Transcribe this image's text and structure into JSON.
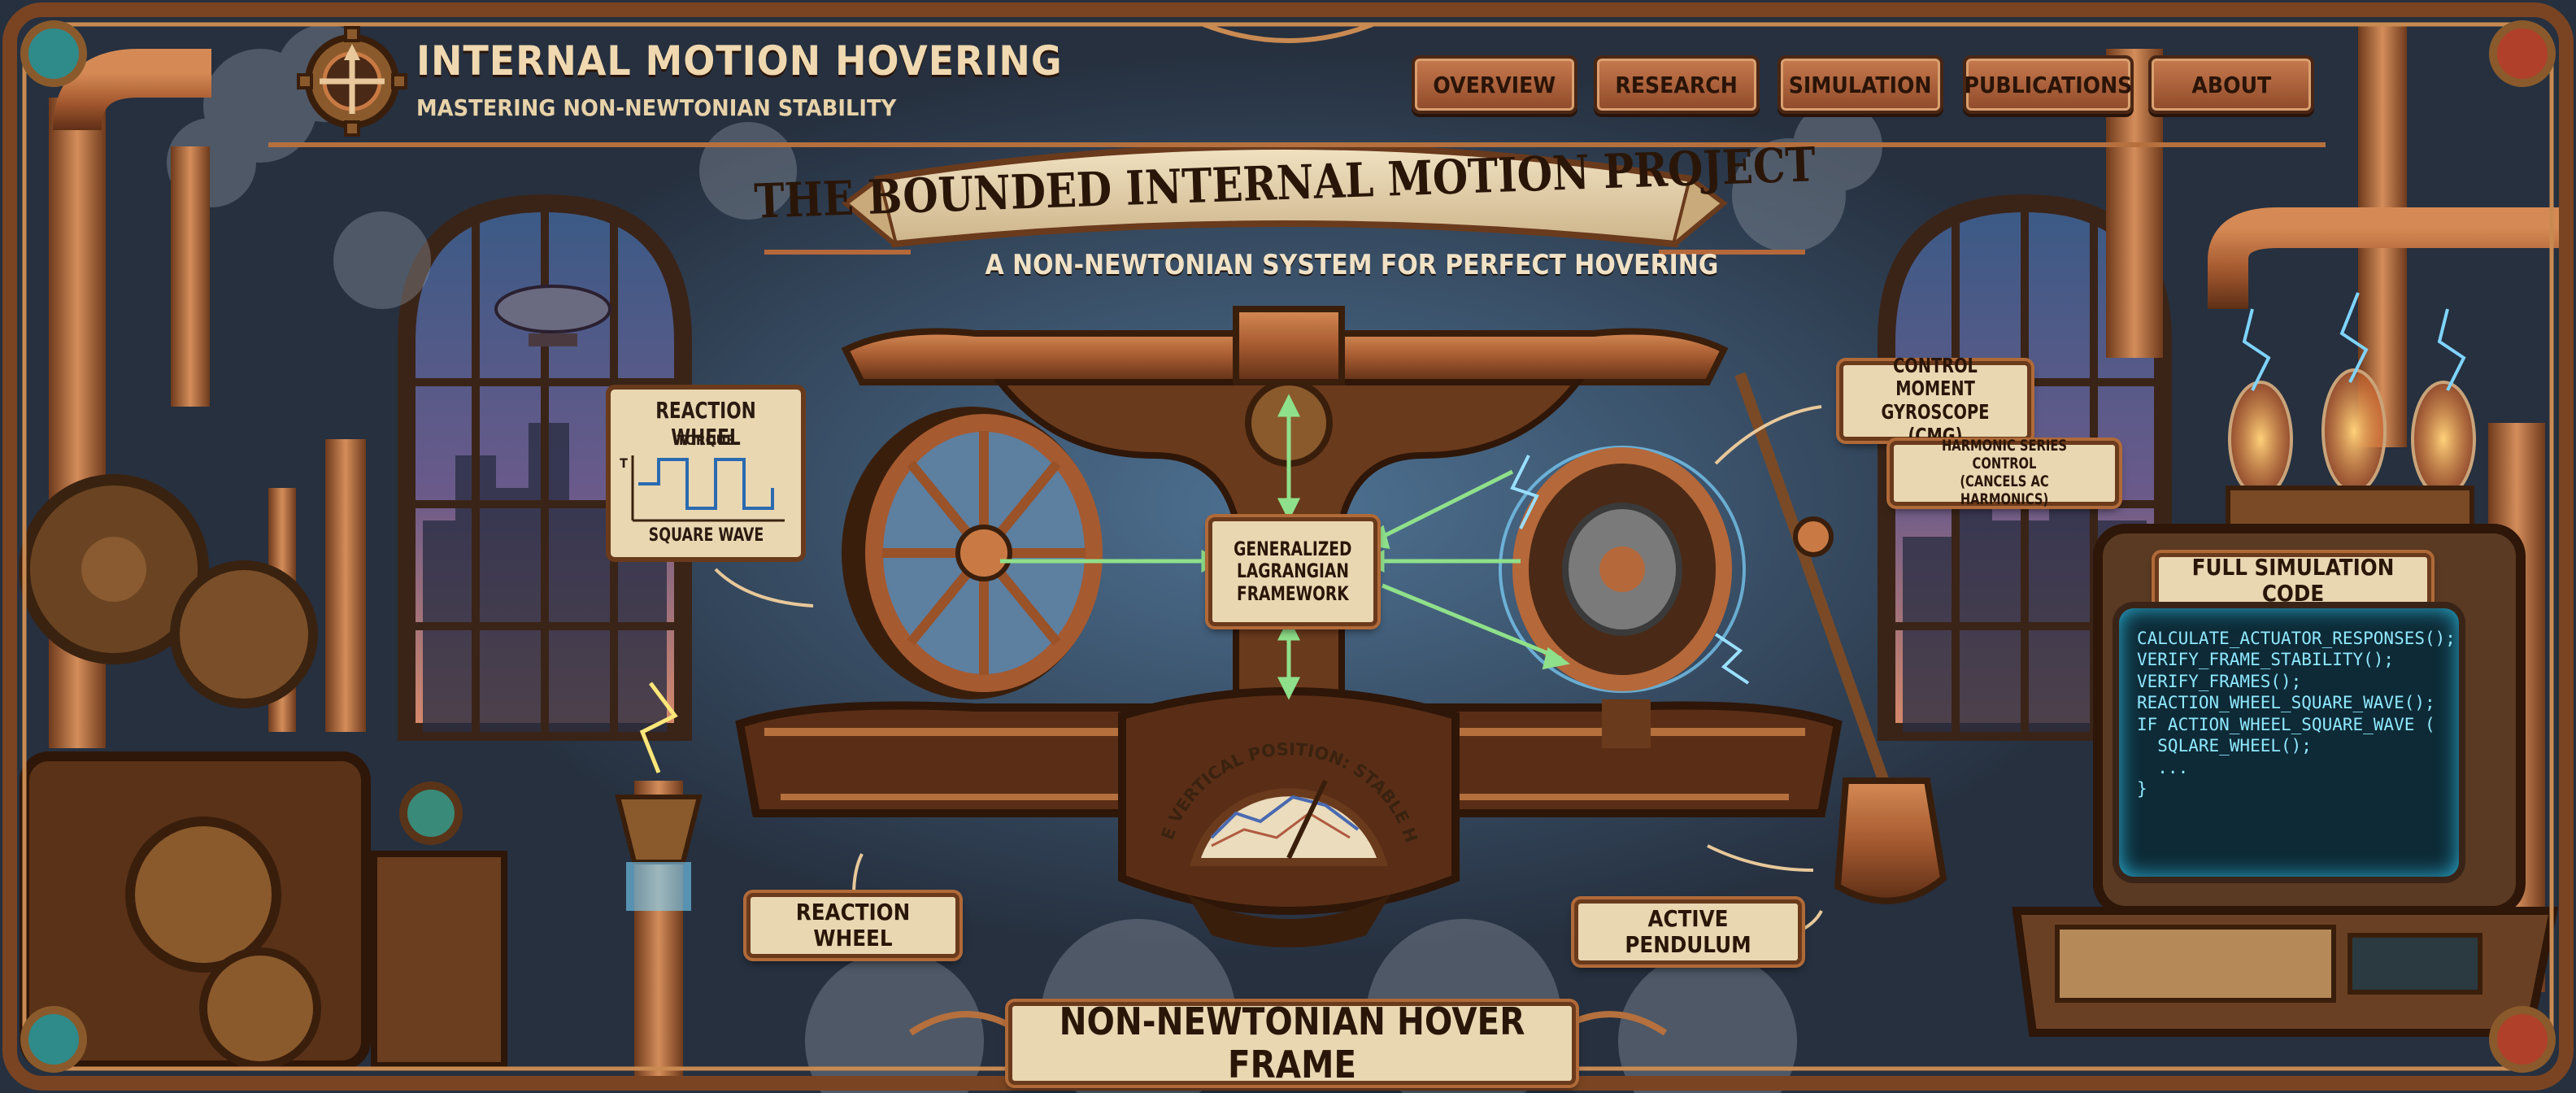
{
  "header": {
    "title": "INTERNAL MOTION HOVERING",
    "subtitle": "MASTERING NON-NEWTONIAN STABILITY",
    "logo_icon": "gear-compass-icon"
  },
  "nav": {
    "items": [
      {
        "label": "OVERVIEW"
      },
      {
        "label": "RESEARCH"
      },
      {
        "label": "SIMULATION"
      },
      {
        "label": "PUBLICATIONS"
      },
      {
        "label": "ABOUT"
      }
    ]
  },
  "hero": {
    "title": "THE BOUNDED INTERNAL MOTION PROJECT",
    "subtitle": "A NON-NEWTONIAN SYSTEM FOR PERFECT HOVERING"
  },
  "diagram": {
    "reaction_wheel_card": {
      "title": "REACTION WHEEL",
      "axis_label": "TORQUE",
      "axis_marker": "T",
      "caption": "SQUARE WAVE"
    },
    "center_label": [
      "GENERALIZED",
      "LAGRANGIAN",
      "FRAMEWORK"
    ],
    "cmg_label": [
      "CONTROL MOMENT",
      "GYROSCOPE (CMG)"
    ],
    "harmonic_label": [
      "HARMONIC SERIES CONTROL",
      "(CANCELS AC HARMONICS)"
    ],
    "gauge_label": "FRAME VERTICAL POSITION: STABLE HOVER",
    "wheel_label": "REACTION WHEEL",
    "pendulum_label": "ACTIVE PENDULUM",
    "frame_label": "NON-NEWTONIAN HOVER FRAME"
  },
  "terminal": {
    "title": "FULL SIMULATION CODE",
    "code_lines": [
      "CALCULATE_ACTUATOR_RESPONSES();",
      "",
      "VERIFY_FRAME_STABILITY();",
      "VERIFY_FRAMES();",
      "REACTION_WHEEL_SQUARE_WAVE();",
      "",
      "IF ACTION_WHEEL_SQUARE_WAVE (",
      "  SQLARE_WHEEL();",
      "  ...",
      "}"
    ]
  },
  "colors": {
    "copper": "#b5683a",
    "dark_bronze": "#4a2614",
    "parchment": "#e9d7b2",
    "arrow_green": "#8fe08a",
    "spark_blue": "#7fd4ff",
    "screen_cyan": "#8fe8ff"
  }
}
